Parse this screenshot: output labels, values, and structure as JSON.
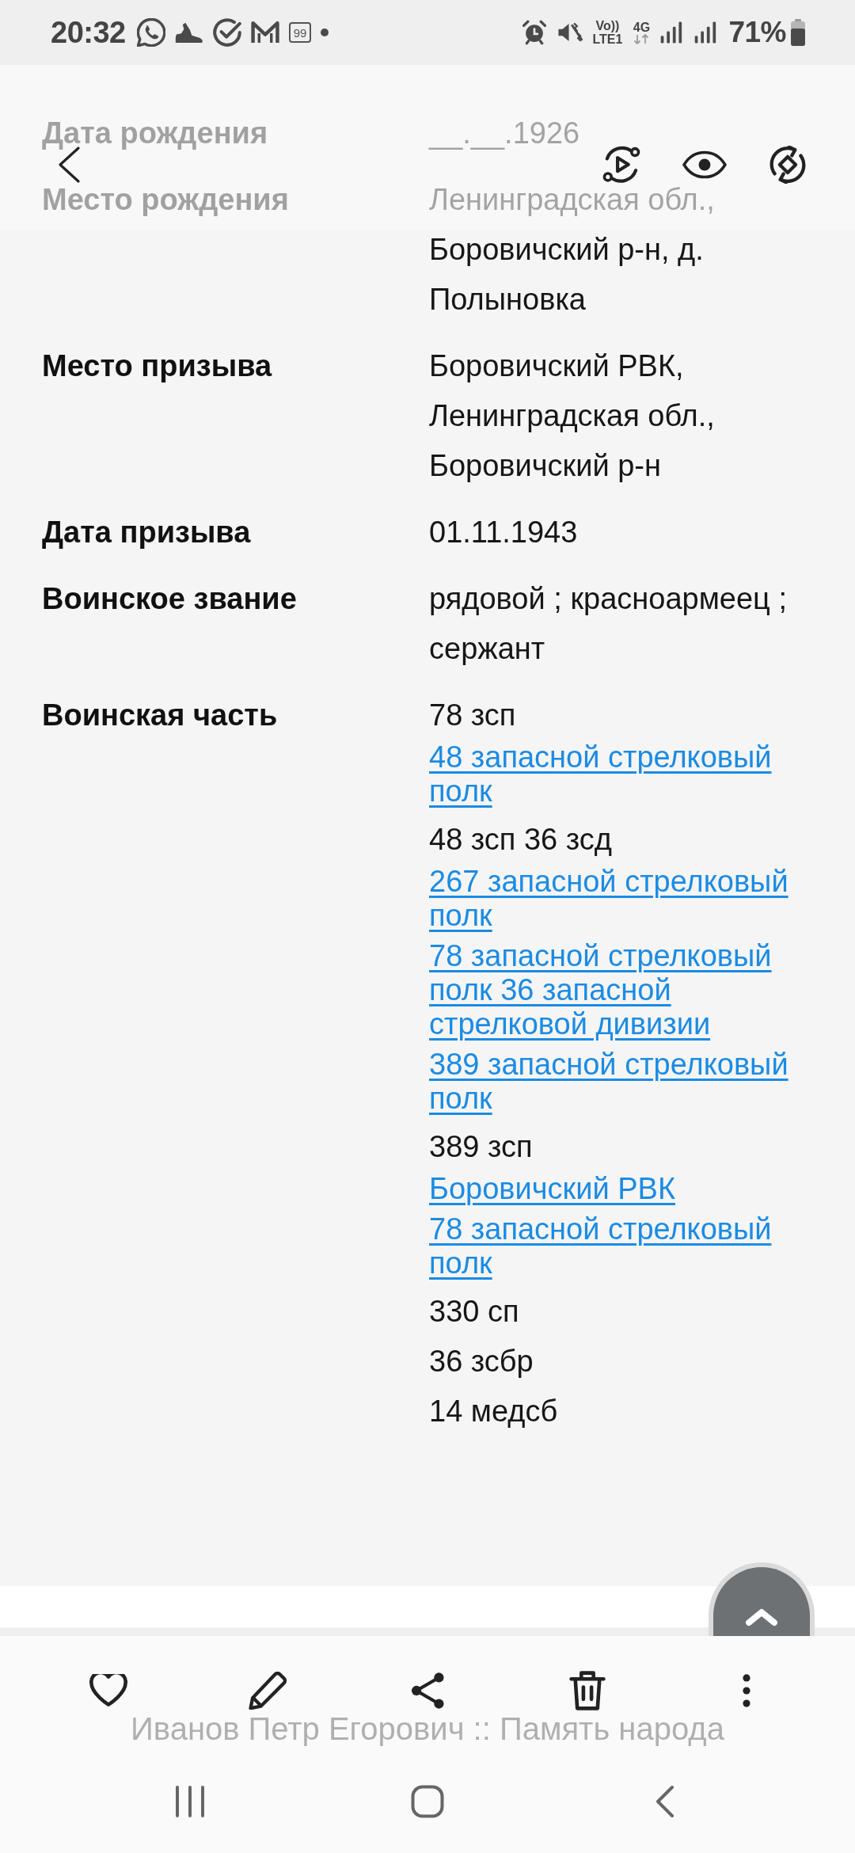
{
  "status_bar": {
    "time": "20:32",
    "notification_count": "99",
    "volte_label": "Vo))",
    "lte_label": "LTE1",
    "network_label": "4G",
    "battery_percent": "71%"
  },
  "record": [
    {
      "label": "Дата рождения",
      "values": [
        {
          "kind": "text",
          "text": "__.__.1926"
        }
      ]
    },
    {
      "label": "Место рождения",
      "values": [
        {
          "kind": "text",
          "text": "Ленинградская обл.,\nБоровичский р-н, д.\nПолыновка"
        }
      ]
    },
    {
      "label": "Место призыва",
      "values": [
        {
          "kind": "text",
          "text": "Боровичский РВК,\nЛенинградская обл.,\nБоровичский р-н"
        }
      ]
    },
    {
      "label": "Дата призыва",
      "values": [
        {
          "kind": "text",
          "text": "01.11.1943"
        }
      ]
    },
    {
      "label": "Воинское звание",
      "values": [
        {
          "kind": "text",
          "text": "рядовой ; красноармеец ;\nсержант"
        }
      ]
    },
    {
      "label": "Воинская часть",
      "values": [
        {
          "kind": "text",
          "text": "78 зсп"
        },
        {
          "kind": "link",
          "text": "48 запасной стрелковый\nполк"
        },
        {
          "kind": "text",
          "text": "48 зсп 36 зсд"
        },
        {
          "kind": "link",
          "text": "267 запасной стрелковый\nполк"
        },
        {
          "kind": "link",
          "text": "78 запасной стрелковый\nполк 36 запасной\nстрелковой дивизии"
        },
        {
          "kind": "link",
          "text": "389 запасной стрелковый\nполк"
        },
        {
          "kind": "text",
          "text": "389 зсп"
        },
        {
          "kind": "link",
          "text": "Боровичский РВК"
        },
        {
          "kind": "link",
          "text": "78 запасной стрелковый\nполк"
        },
        {
          "kind": "text",
          "text": "330 сп"
        },
        {
          "kind": "text",
          "text": "36 зсбр"
        },
        {
          "kind": "text",
          "text": "14 медсб"
        }
      ]
    }
  ],
  "page_title": "Иванов Петр Егорович :: Память народа"
}
